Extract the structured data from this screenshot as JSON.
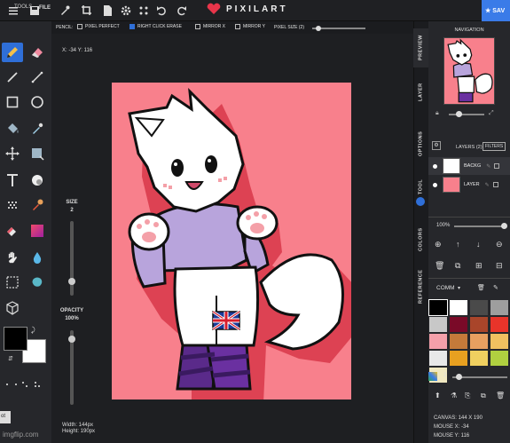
{
  "topbar": {
    "file_label": "FILE",
    "logo_text": "PIXILART",
    "save_label": "SAV"
  },
  "tools": {
    "title": "TOOLS",
    "icons": [
      "pencil-icon",
      "eraser-icon",
      "line-icon",
      "pen-icon",
      "rectangle-icon",
      "circle-icon",
      "fill-bucket-icon",
      "eyedropper-icon",
      "move-icon",
      "select-icon",
      "text-icon",
      "sphere-icon",
      "dither-icon",
      "color-picker-icon",
      "paint-icon",
      "gradient-icon",
      "hand-icon",
      "drop-icon",
      "marquee-icon",
      "lasso-icon",
      "cube-icon"
    ]
  },
  "options": {
    "pencil_label": "PENCIL:",
    "pixel_perfect": "PIXEL PERFECT",
    "right_click_erase": "RIGHT CLICK ERASE",
    "mirror_x": "MIRROR X",
    "mirror_y": "MIRROR Y",
    "pixel_size": "PIXEL SIZE (2)"
  },
  "canvas": {
    "coords": "X: -34 Y: 116",
    "size_label": "SIZE",
    "size_value": "2",
    "opacity_label": "OPACITY",
    "opacity_value": "100%",
    "width_text": "Width: 144px",
    "height_text": "Height: 190px",
    "bg_color": "#f8808c"
  },
  "sidetabs": [
    "PREVIEW",
    "LAYER",
    "OPTIONS",
    "TOOL",
    "COLORS",
    "REFERENCE"
  ],
  "right": {
    "nav_title": "NAVIGATION",
    "layers_title": "LAYERS (2)",
    "filters_label": "FILTERS",
    "layers": [
      {
        "name": "BACKG"
      },
      {
        "name": "LAYER"
      }
    ],
    "zoom": "100%",
    "comm_label": "COMM",
    "palette_count": "2",
    "palette": [
      "#000000",
      "#ffffff",
      "#4a4a4a",
      "#9e9e9e",
      "#c8c8c8",
      "#7a0a28",
      "#a9452a",
      "#e8342a",
      "#f4a0aa",
      "#c47a3a",
      "#e8a060",
      "#f0c060",
      "#e8e8e8",
      "#e8a020",
      "#f0d060",
      "#b0d040",
      "#f0e8c0"
    ],
    "canvas_info": "CANVAS: 144 X 190",
    "mouse_x": "MOUSE X: -34",
    "mouse_y": "MOUSE Y: 116"
  },
  "footer": {
    "watermark": "imgflip.com",
    "tab": "ot"
  }
}
